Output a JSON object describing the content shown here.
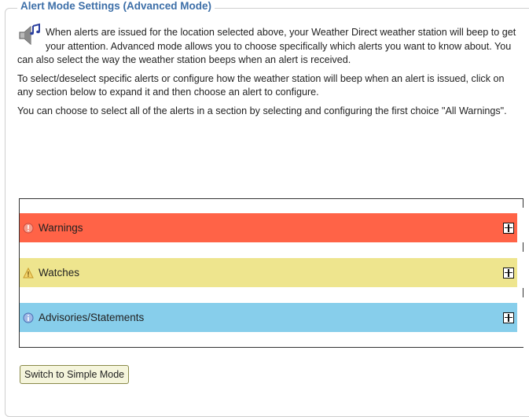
{
  "legend": "Alert Mode Settings (Advanced Mode)",
  "paragraphs": [
    "When alerts are issued for the location selected above, your Weather Direct weather station will beep to get your attention. Advanced mode allows you to choose specifically which alerts you want to know about. You can also select the way the weather station beeps when an alert is received.",
    "To select/deselect specific alerts or configure how the weather station will beep when an alert is issued, click on any section below to expand it and then choose an alert to configure.",
    "You can choose to select all of the alerts in a section by selecting and configuring the first choice \"All Warnings\"."
  ],
  "sections": [
    {
      "label": "Warnings",
      "color": "#ff6347",
      "icon": "warning-circle-icon"
    },
    {
      "label": "Watches",
      "color": "#eee58e",
      "icon": "caution-triangle-icon"
    },
    {
      "label": "Advisories/Statements",
      "color": "#87ceeb",
      "icon": "info-circle-icon"
    }
  ],
  "switch_button_label": "Switch to Simple Mode"
}
